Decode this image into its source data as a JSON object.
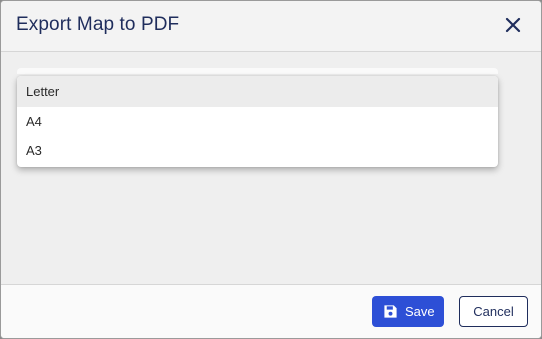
{
  "dialog": {
    "title": "Export Map to PDF",
    "close_icon": "close-icon"
  },
  "page_size_select": {
    "options": [
      "Letter",
      "A4",
      "A3"
    ],
    "highlighted": "Letter"
  },
  "footer": {
    "save_label": "Save",
    "save_icon": "floppy-disk-icon",
    "cancel_label": "Cancel"
  },
  "colors": {
    "primary": "#2d4fd6",
    "title_text": "#1f2d5c",
    "highlight": "#ececec"
  }
}
